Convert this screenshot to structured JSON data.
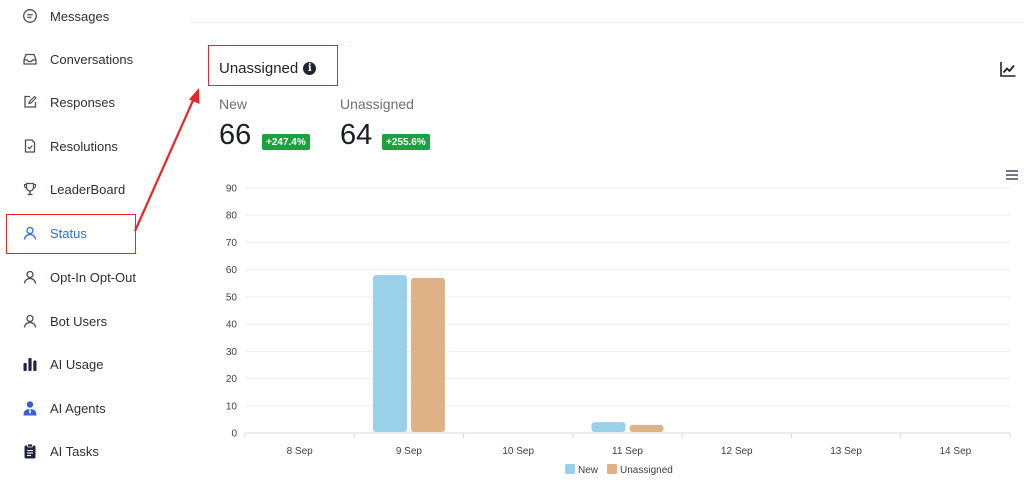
{
  "sidebar": {
    "items": [
      {
        "label": "Messages",
        "icon": "message-bubble-icon",
        "active": false
      },
      {
        "label": "Conversations",
        "icon": "inbox-icon",
        "active": false
      },
      {
        "label": "Responses",
        "icon": "edit-icon",
        "active": false
      },
      {
        "label": "Resolutions",
        "icon": "document-check-icon",
        "active": false
      },
      {
        "label": "LeaderBoard",
        "icon": "trophy-icon",
        "active": false
      },
      {
        "label": "Status",
        "icon": "user-icon",
        "active": true
      },
      {
        "label": "Opt-In Opt-Out",
        "icon": "user-icon",
        "active": false
      },
      {
        "label": "Bot Users",
        "icon": "user-icon",
        "active": false
      },
      {
        "label": "AI Usage",
        "icon": "bar-chart-icon",
        "active": false
      },
      {
        "label": "AI Agents",
        "icon": "agent-icon",
        "active": false
      },
      {
        "label": "AI Tasks",
        "icon": "clipboard-icon",
        "active": false
      }
    ]
  },
  "card": {
    "title": "Unassigned",
    "stats": [
      {
        "label": "New",
        "value": "66",
        "change": "+247.4%"
      },
      {
        "label": "Unassigned",
        "value": "64",
        "change": "+255.6%"
      }
    ]
  },
  "colors": {
    "accent": "#2f6fd6",
    "highlight": "#e5262b",
    "badge": "#1ca13f",
    "series_new": "#9bd0ea",
    "series_unassigned": "#deb287"
  },
  "chart_data": {
    "type": "bar",
    "categories": [
      "8 Sep",
      "9 Sep",
      "10 Sep",
      "11 Sep",
      "12 Sep",
      "13 Sep",
      "14 Sep"
    ],
    "series": [
      {
        "name": "New",
        "values": [
          0,
          58,
          0,
          4,
          0,
          0,
          0
        ],
        "color": "#9bd0ea"
      },
      {
        "name": "Unassigned",
        "values": [
          0,
          57,
          0,
          3,
          0,
          0,
          0
        ],
        "color": "#deb287"
      }
    ],
    "ylim": [
      0,
      90
    ],
    "yticks": [
      0,
      10,
      20,
      30,
      40,
      50,
      60,
      70,
      80,
      90
    ],
    "grid": true,
    "legend": "bottom-center"
  }
}
